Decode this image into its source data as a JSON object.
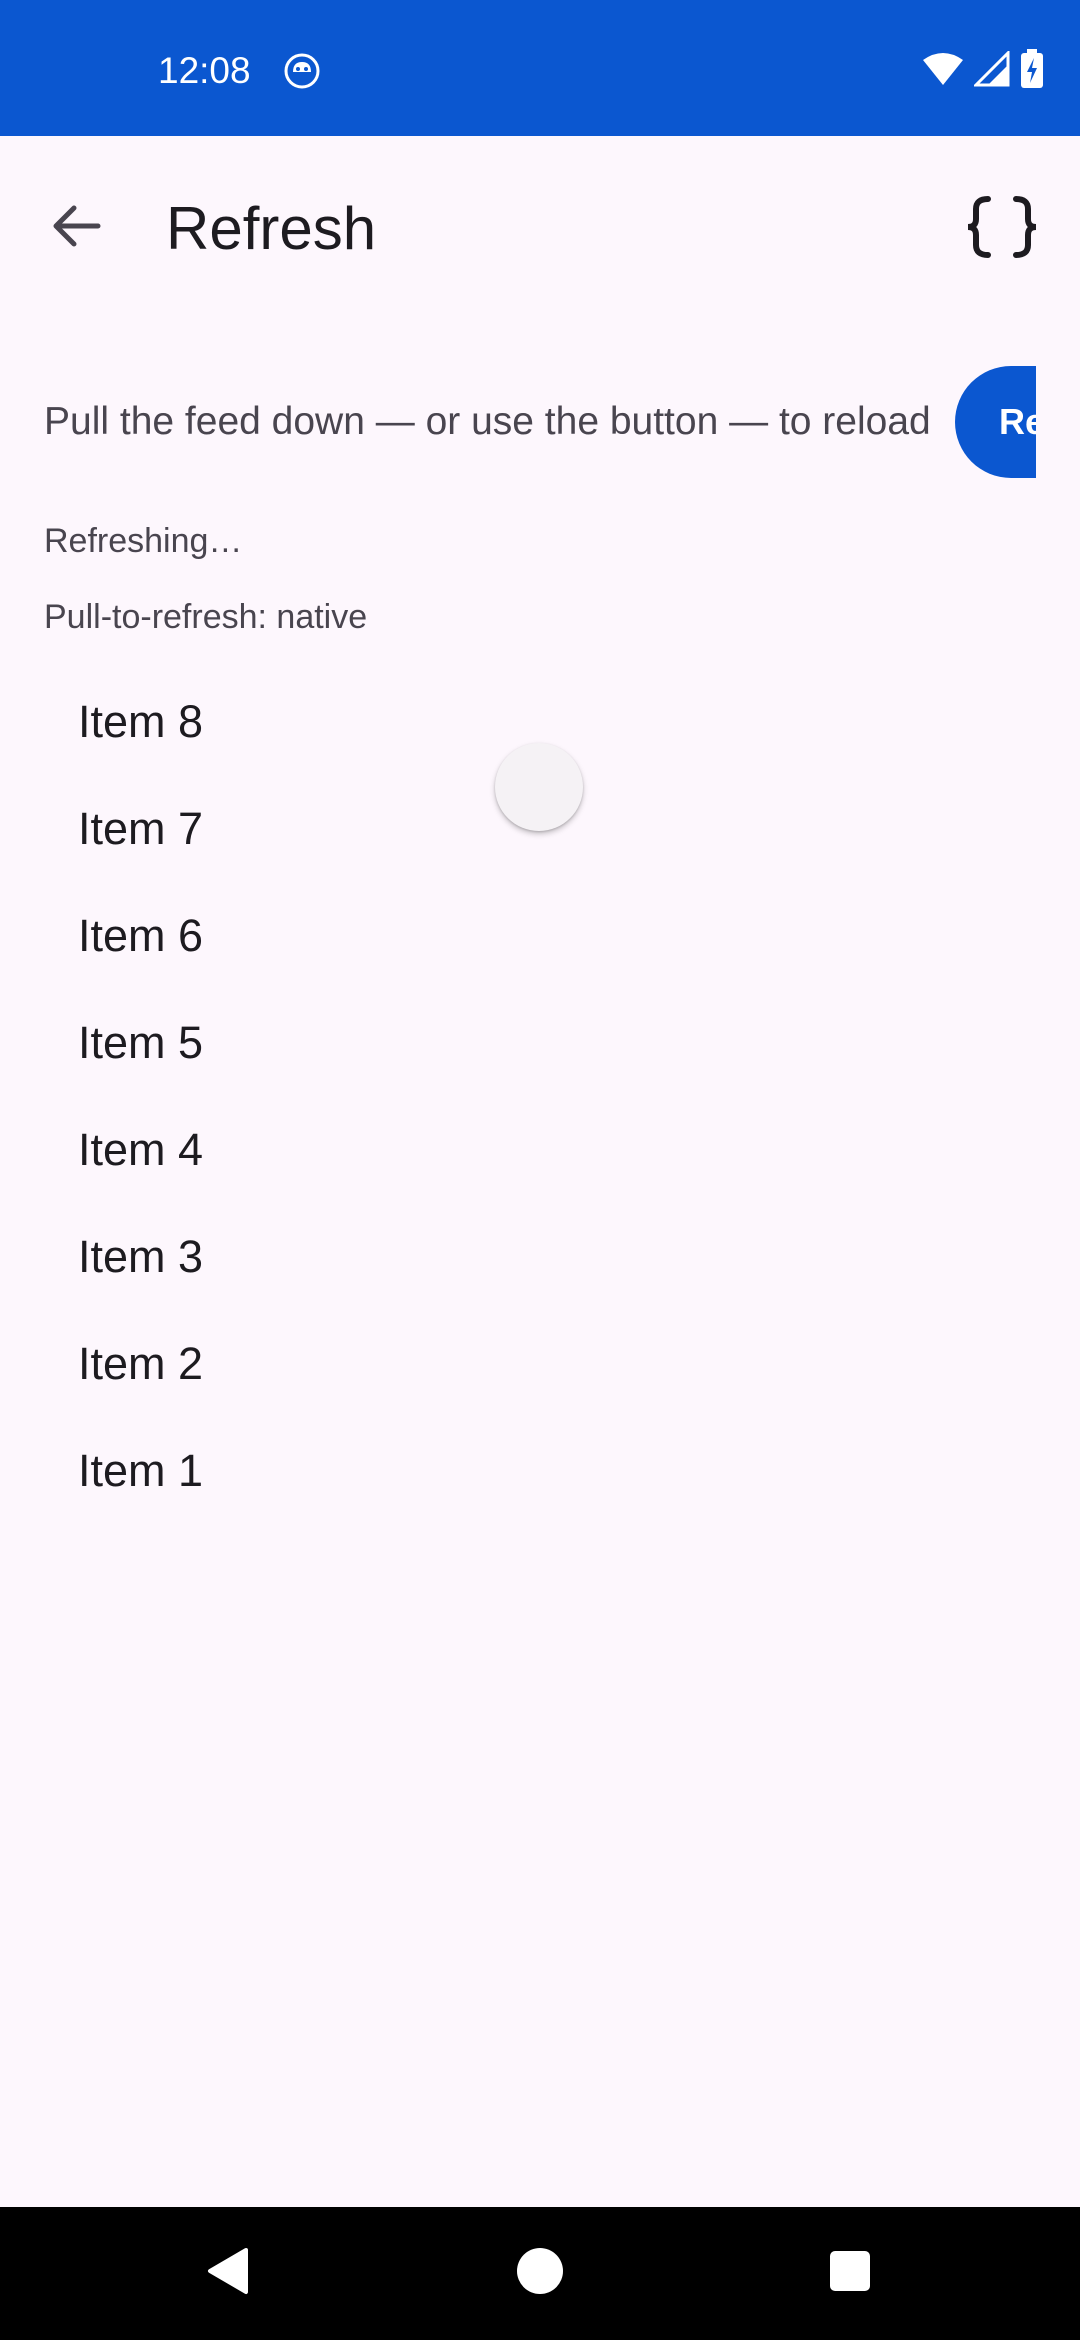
{
  "status_bar": {
    "time": "12:08",
    "icons": [
      "notification-icon",
      "wifi-icon",
      "cellular-signal-icon",
      "battery-charging-icon"
    ],
    "background": "#0b57d0"
  },
  "app_bar": {
    "back_icon": "arrow-back-icon",
    "title": "Refresh",
    "action_icon": "code-braces-icon"
  },
  "content": {
    "instructions": "Pull the feed down — or use the button — to reload",
    "refresh_button_label": "Refresh",
    "status_text": "Refreshing…",
    "mode_text": "Pull-to-refresh: native",
    "items": [
      "Item 8",
      "Item 7",
      "Item 6",
      "Item 5",
      "Item 4",
      "Item 3",
      "Item 2",
      "Item 1"
    ],
    "accent": "#0b57d0"
  },
  "nav_bar": {
    "buttons": [
      "back-triangle-icon",
      "home-circle-icon",
      "recents-square-icon"
    ]
  }
}
